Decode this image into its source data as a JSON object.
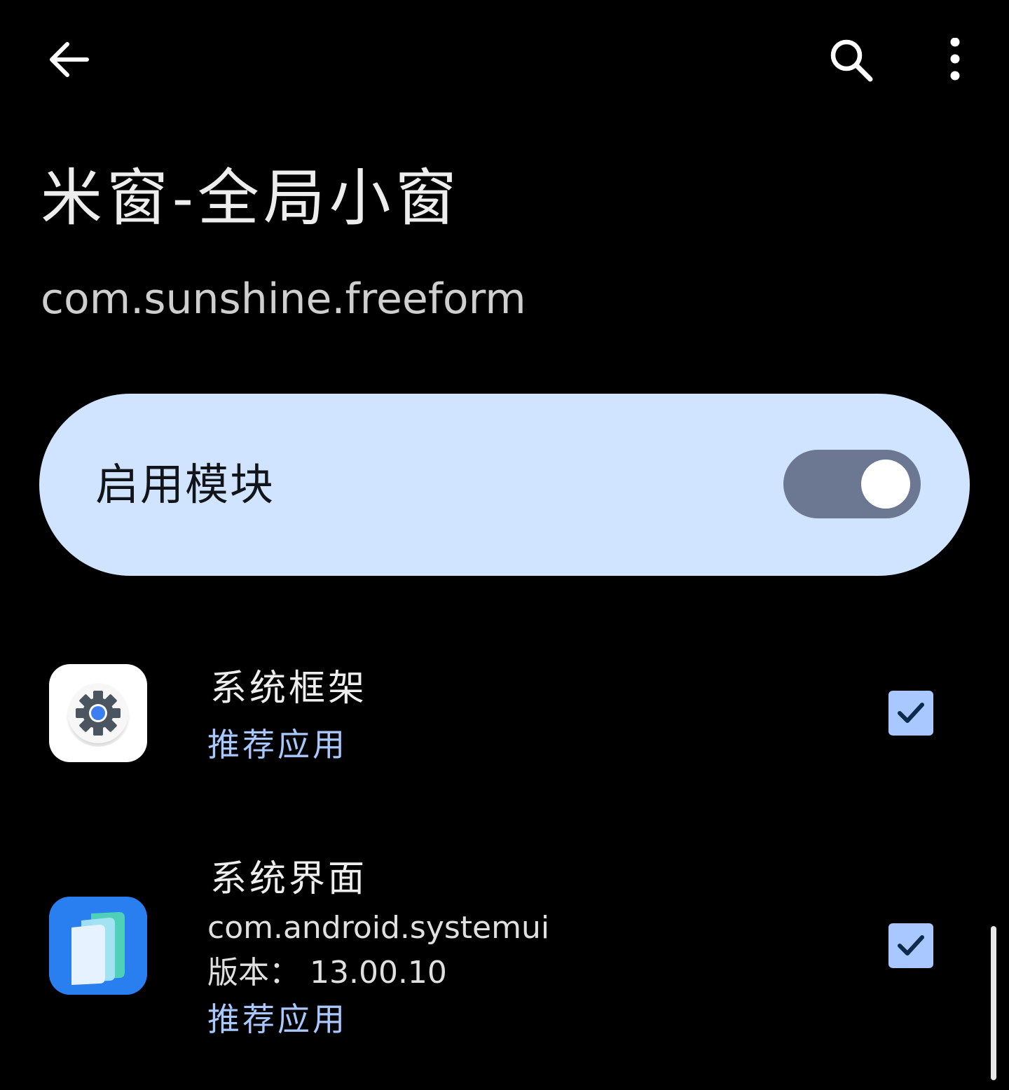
{
  "toolbar": {
    "back_icon": "arrow-back-icon",
    "search_icon": "search-icon",
    "more_icon": "more-vert-icon"
  },
  "header": {
    "title": "米窗-全局小窗",
    "package": "com.sunshine.freeform"
  },
  "enable": {
    "label": "启用模块",
    "enabled": true
  },
  "apps": [
    {
      "name": "系统框架",
      "recommended": "推荐应用",
      "checked": true,
      "icon": "settings-gear-icon"
    },
    {
      "name": "系统界面",
      "package": "com.android.systemui",
      "version": "版本： 13.00.10",
      "recommended": "推荐应用",
      "checked": true,
      "icon": "systemui-icon"
    }
  ],
  "colors": {
    "background": "#000000",
    "card": "#d0e4ff",
    "accent": "#a8c8ff",
    "toggle_track": "#6c7891"
  }
}
